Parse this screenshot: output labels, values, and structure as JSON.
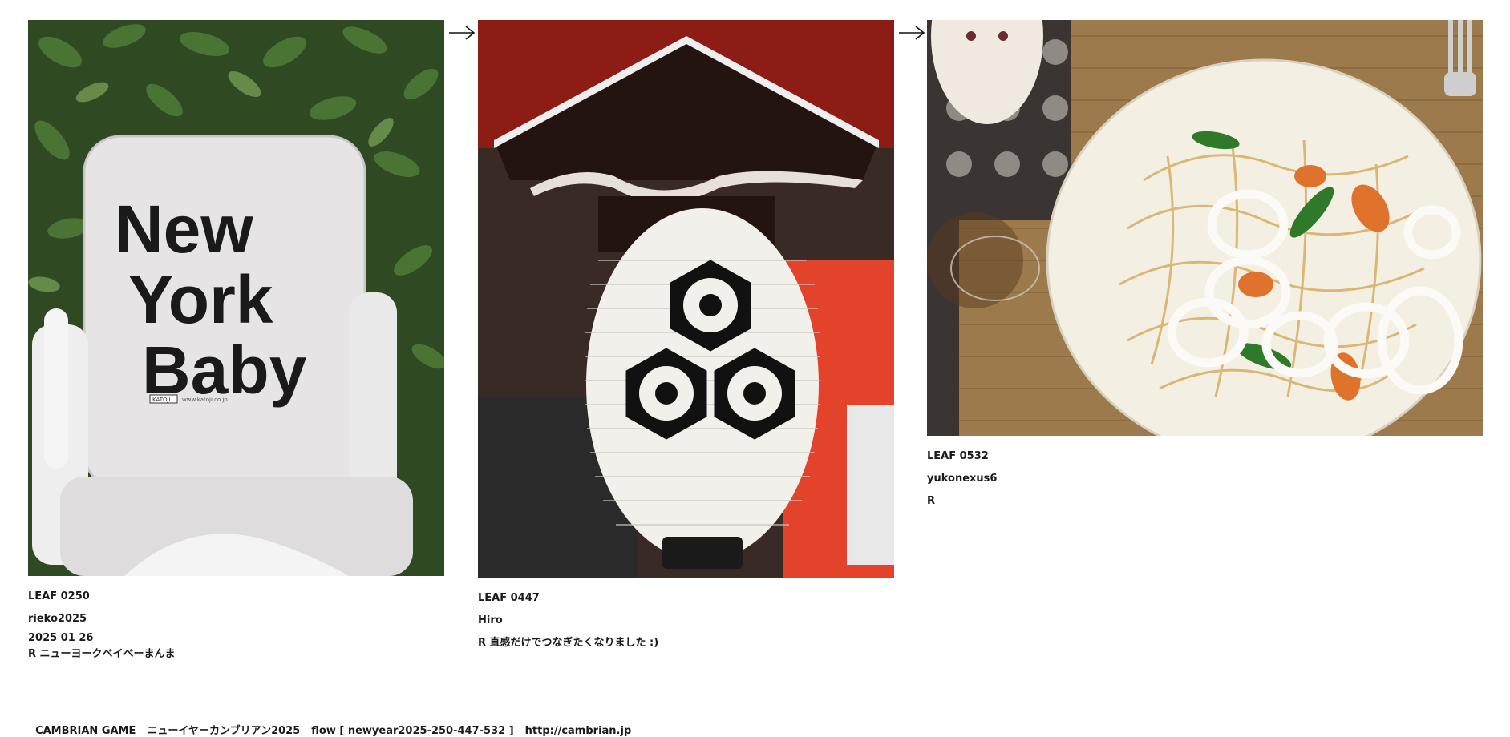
{
  "leaves": [
    {
      "id": "LEAF 0250",
      "user": "rieko2025",
      "date": "2025 01 26",
      "comment": "R ニューヨークベイベーまんま",
      "photo_text": [
        "New",
        "York",
        "Baby"
      ],
      "photo_brand": "KATOJI",
      "photo_url": "www.katoji.co.jp"
    },
    {
      "id": "LEAF 0447",
      "user": "Hiro",
      "comment": "R 直感だけでつなぎたくなりました :)"
    },
    {
      "id": "LEAF 0532",
      "user": "yukonexus6",
      "comment": "R"
    }
  ],
  "footer": {
    "game": "CAMBRIAN GAME",
    "title": "ニューイヤーカンブリアン2025",
    "flow": "flow [ newyear2025-250-447-532 ]",
    "url": "http://cambrian.jp"
  },
  "icons": {
    "arrow": "right-arrow-icon"
  }
}
